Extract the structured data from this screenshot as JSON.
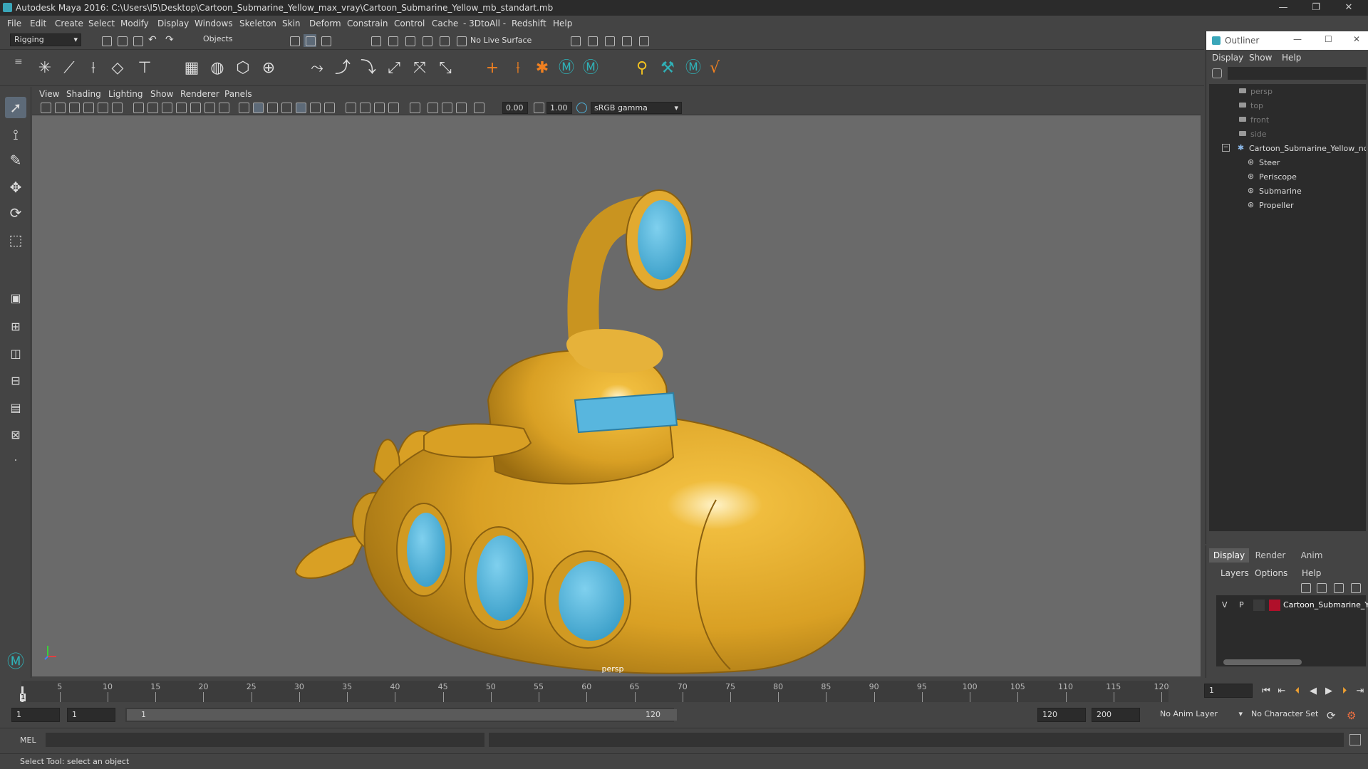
{
  "window": {
    "title": "Autodesk Maya 2016: C:\\Users\\I5\\Desktop\\Cartoon_Submarine_Yellow_max_vray\\Cartoon_Submarine_Yellow_mb_standart.mb",
    "minimize": "—",
    "restore": "❐",
    "close": "✕"
  },
  "menubar": [
    "File",
    "Edit",
    "Create",
    "Select",
    "Modify",
    "Display",
    "Windows",
    "Skeleton",
    "Skin",
    "Deform",
    "Constrain",
    "Control",
    "Cache",
    "- 3DtoAll -",
    "Redshift",
    "Help"
  ],
  "statusline": {
    "menuset": "Rigging",
    "selection_mode": "Objects",
    "live_surface": "No Live Surface"
  },
  "viewport": {
    "menus": [
      "View",
      "Shading",
      "Lighting",
      "Show",
      "Renderer",
      "Panels"
    ],
    "exposure": "0.00",
    "gamma": "1.00",
    "color_space": "sRGB gamma",
    "camera": "persp"
  },
  "outliner": {
    "title": "Outliner",
    "menus": [
      "Display",
      "Show",
      "Help"
    ],
    "cameras": [
      "persp",
      "top",
      "front",
      "side"
    ],
    "root": "Cartoon_Submarine_Yellow_nc",
    "children": [
      "Steer",
      "Periscope",
      "Submarine",
      "Propeller"
    ]
  },
  "layer_editor": {
    "tabs": [
      "Display",
      "Render",
      "Anim"
    ],
    "menus": [
      "Layers",
      "Options",
      "Help"
    ],
    "layer": {
      "visible": "V",
      "playback": "P",
      "name": "Cartoon_Submarine_Ye",
      "color": "#b0102a"
    }
  },
  "timeline": {
    "ticks": [
      "5",
      "10",
      "15",
      "20",
      "25",
      "30",
      "35",
      "40",
      "45",
      "50",
      "55",
      "60",
      "65",
      "70",
      "75",
      "80",
      "85",
      "90",
      "95",
      "100",
      "105",
      "110",
      "115",
      "120"
    ],
    "current_frame_marker": "1",
    "current_frame": "1"
  },
  "range": {
    "start": "1",
    "playback_start": "1",
    "slider_start": "1",
    "slider_end": "120",
    "playback_end": "120",
    "end": "200",
    "anim_layer": "No Anim Layer",
    "character_set": "No Character Set"
  },
  "command": {
    "language": "MEL"
  },
  "helpline": "Select Tool: select an object",
  "colors": {
    "submarine_yellow": "#e0a52a",
    "window_blue": "#4fb0d8",
    "viewport_bg": "#6a6a6a",
    "ui_bg": "#444444"
  }
}
